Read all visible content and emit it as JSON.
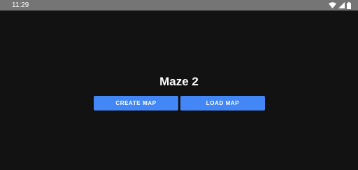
{
  "status_bar": {
    "time": "11:29",
    "icons": [
      "wifi-icon",
      "signal-icon",
      "battery-icon"
    ],
    "background": "#757575"
  },
  "app": {
    "background": "#121212",
    "title": "Maze 2",
    "accent": "#4287f5",
    "buttons": {
      "create_map": "CREATE MAP",
      "load_map": "LOAD MAP"
    }
  }
}
